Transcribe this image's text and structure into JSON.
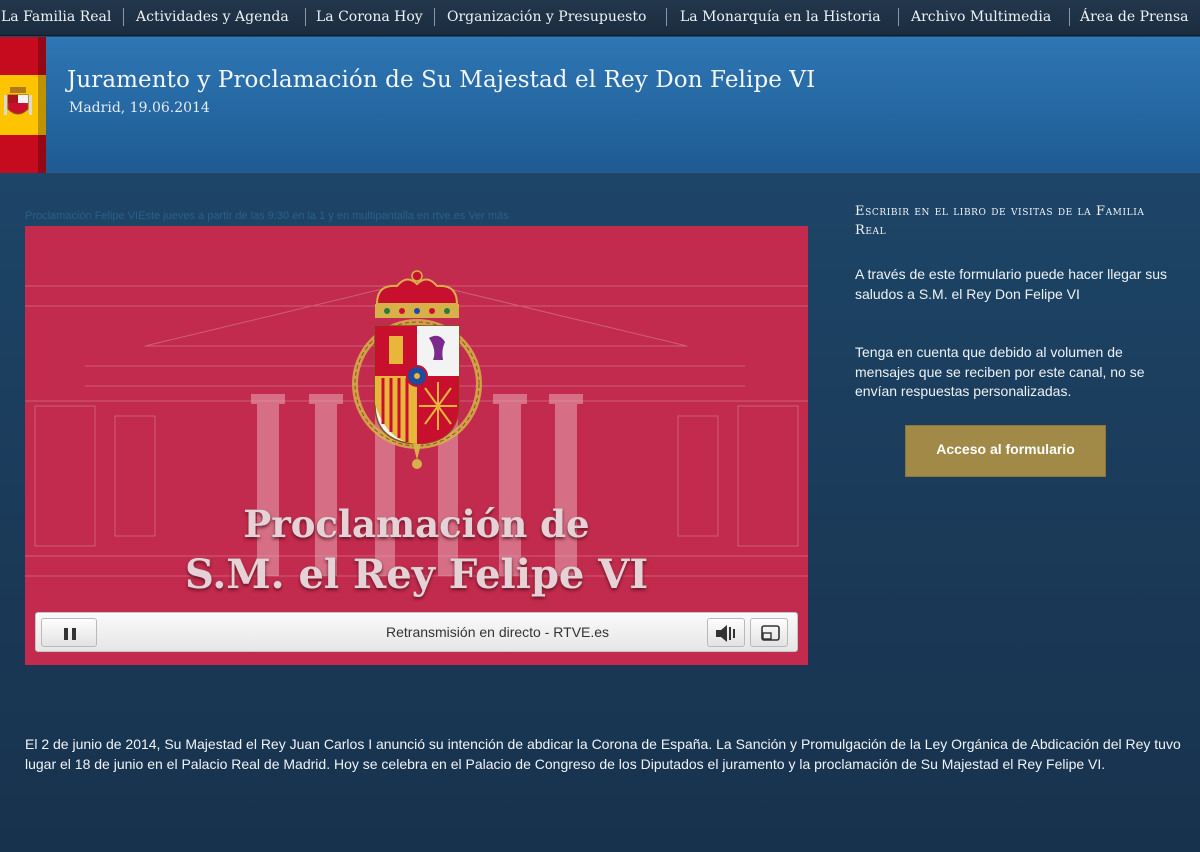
{
  "nav": {
    "items": [
      {
        "label": "La Familia Real"
      },
      {
        "label": "Actividades y Agenda"
      },
      {
        "label": "La Corona Hoy"
      },
      {
        "label": "Organización y Presupuesto"
      },
      {
        "label": "La Monarquía en la Historia"
      },
      {
        "label": "Archivo Multimedia"
      },
      {
        "label": "Área de Prensa"
      }
    ]
  },
  "header": {
    "title": "Juramento y Proclamación de Su Majestad el Rey Don Felipe VI",
    "date": "Madrid, 19.06.2014"
  },
  "ticker": {
    "text": "Proclamación Felipe VIEste jueves a partir de las 9:30 en la 1 y en multipantalla en rtve.es Ver más"
  },
  "video": {
    "title_line1": "Proclamación de",
    "title_line2": "S.M. el Rey Felipe VI",
    "live_label": "Retransmisión en directo - RTVE.es",
    "pause_icon": "pause-icon",
    "volume_icon": "volume-icon",
    "fullscreen_icon": "fullscreen-icon"
  },
  "guestbook": {
    "title": "Escribir en el libro de visitas de la Familia Real",
    "para1": "A través de este formulario puede hacer llegar sus saludos a S.M. el Rey Don Felipe VI",
    "para2": "Tenga en cuenta que debido al volumen de mensajes que se reciben por este canal, no se envían respuestas personalizadas.",
    "button_label": "Acceso al formulario"
  },
  "body": {
    "text": "El 2 de junio de 2014, Su Majestad el Rey Juan Carlos I anunció su intención de abdicar la Corona de España. La Sanción y Promulgación de la Ley Orgánica de Abdicación del Rey tuvo lugar el 18 de junio en el Palacio Real de Madrid. Hoy se celebra en el Palacio de Congreso de los Diputados el juramento y la proclamación de Su Majestad el Rey Felipe VI."
  },
  "colors": {
    "nav_bg": "#1a2c3f",
    "header_blue": "#2466a1",
    "page_bg": "#1b3b5a",
    "video_red": "#c22b4d",
    "button_gold": "#a18a48"
  }
}
